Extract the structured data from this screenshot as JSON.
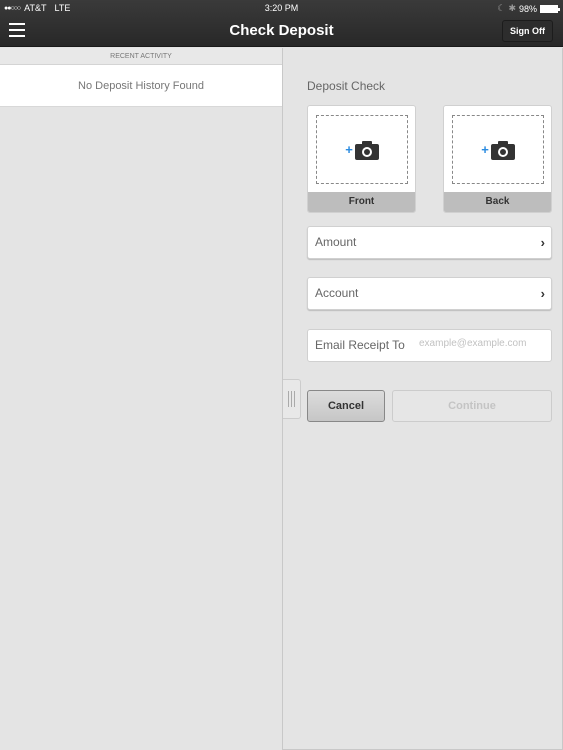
{
  "status_bar": {
    "signal": "●●○○○",
    "carrier": "AT&T",
    "network": "LTE",
    "time": "3:20 PM",
    "moon_icon": "☾",
    "bluetooth_icon": "✱",
    "battery": "98%"
  },
  "header": {
    "menu_icon": "hamburger-icon",
    "title": "Check Deposit",
    "sign_off_label": "Sign Off"
  },
  "recent_activity": {
    "heading": "Recent Activity",
    "empty_message": "No Deposit History Found"
  },
  "deposit": {
    "title": "Deposit Check",
    "front_label": "Front",
    "back_label": "Back",
    "plus_glyph": "+",
    "amount_label": "Amount",
    "account_label": "Account",
    "chevron": "›",
    "email_label": "Email Receipt To",
    "email_placeholder": "example@example.com",
    "email_value": "",
    "cancel_label": "Cancel",
    "continue_label": "Continue"
  },
  "colors": {
    "accent": "#2a8be0",
    "header_bg": "#2d2d2d"
  }
}
